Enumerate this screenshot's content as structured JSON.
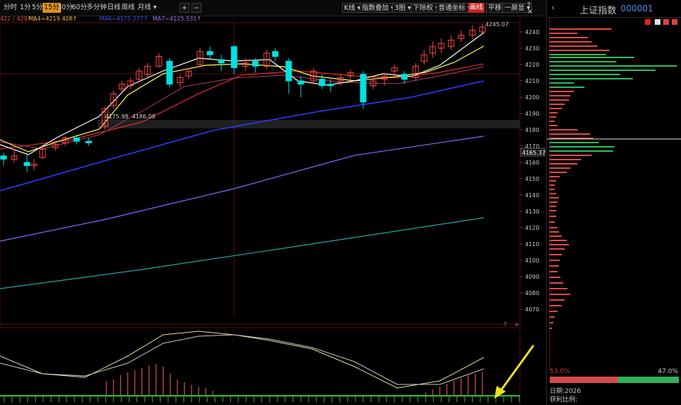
{
  "toolbar": {
    "left_tabs": [
      "分时",
      "1分",
      "5分",
      "15分",
      "30分",
      "60分",
      "多分钟",
      "日线",
      "周线",
      "月线 ▾"
    ],
    "active_tab": "15分",
    "plus": "+",
    "minus": "−",
    "right_buttons": [
      "K线 ▾",
      "指数叠加 ▾",
      "3图 ▾",
      "下除权 ▾",
      "普通坐标 ▾",
      "画线",
      "平移",
      "一屏显 ▾"
    ],
    "help": "?",
    "close": "×"
  },
  "ma_legend": {
    "partial": "422 ( 4297 )",
    "ma4": "MA4=4219.408↑",
    "ma6": "MA6=4175.277↑",
    "ma7": "MA7=4125.531↑"
  },
  "price_axis": [
    "4240",
    "4230",
    "4220",
    "4210",
    "4200",
    "4190",
    "4180",
    "4170",
    "4160",
    "4150",
    "4140",
    "4130",
    "4120",
    "4110",
    "4100",
    "4090",
    "4080",
    "4070"
  ],
  "annotations": {
    "high_label": "4245.07",
    "low_label_a": "4175.98",
    "low_label_b": "4186.08",
    "current_price": "4165.37"
  },
  "sub_panel": {
    "help": "?",
    "close": "×"
  },
  "colors": {
    "up": "#ff4646",
    "down": "#00e0e0",
    "ma_short": "#ffffff",
    "ma_mid": "#ffff55",
    "ma_long_red": "#ff3030",
    "ma_blue": "#2a3cff",
    "ma_violet": "#7a6cff",
    "ma_cyan": "#20a8a0"
  },
  "right_panel": {
    "back_arrow": "‹",
    "name": "上证指数",
    "code": "000001",
    "profit_pct": "53.0%",
    "loss_pct": "47.0%",
    "line1": "日期:2026",
    "line2": "获利比例:"
  }
}
